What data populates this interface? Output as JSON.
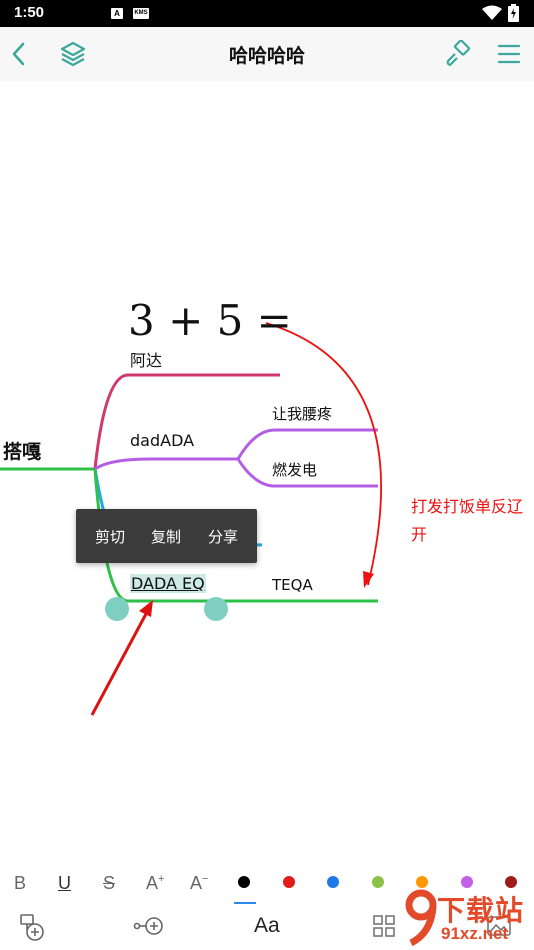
{
  "status_bar": {
    "time": "1:50",
    "notif_a": "A",
    "notif_b": "KMS"
  },
  "app_bar": {
    "title": "哈哈哈哈"
  },
  "mind_map": {
    "formula": "3 + 5 =",
    "root": "搭嘎",
    "node_ada": "阿达",
    "node_dadada": "dadADA",
    "child_1": "让我腰疼",
    "child_2": "燃发电",
    "selected_node": "DADA EQ",
    "node_teqa": "TEQA",
    "annotation_line1": "打发打饭单反辽",
    "annotation_line2": "开"
  },
  "context_menu": {
    "cut": "剪切",
    "copy": "复制",
    "share": "分享"
  },
  "format_toolbar": {
    "bold": "B",
    "underline": "U",
    "strike": "S",
    "font_larger": "A",
    "font_larger_sup": "+",
    "font_smaller": "A",
    "font_smaller_sup": "−",
    "colors": [
      "#000000",
      "#e21b1b",
      "#1f78e6",
      "#8bc34a",
      "#ff9800",
      "#c061e8",
      "#a01c1c"
    ],
    "selected_color": "#000000"
  },
  "bottom_toolbar": {
    "text_style": "Aa"
  },
  "watermark": {
    "brand": "下载站",
    "domain": "91xz.net"
  },
  "colors": {
    "accent": "#3aa89b",
    "branch_green": "#2ec14a",
    "branch_pink": "#d1386d",
    "branch_purple": "#b45ee6",
    "annotation_red": "#ee1111"
  }
}
